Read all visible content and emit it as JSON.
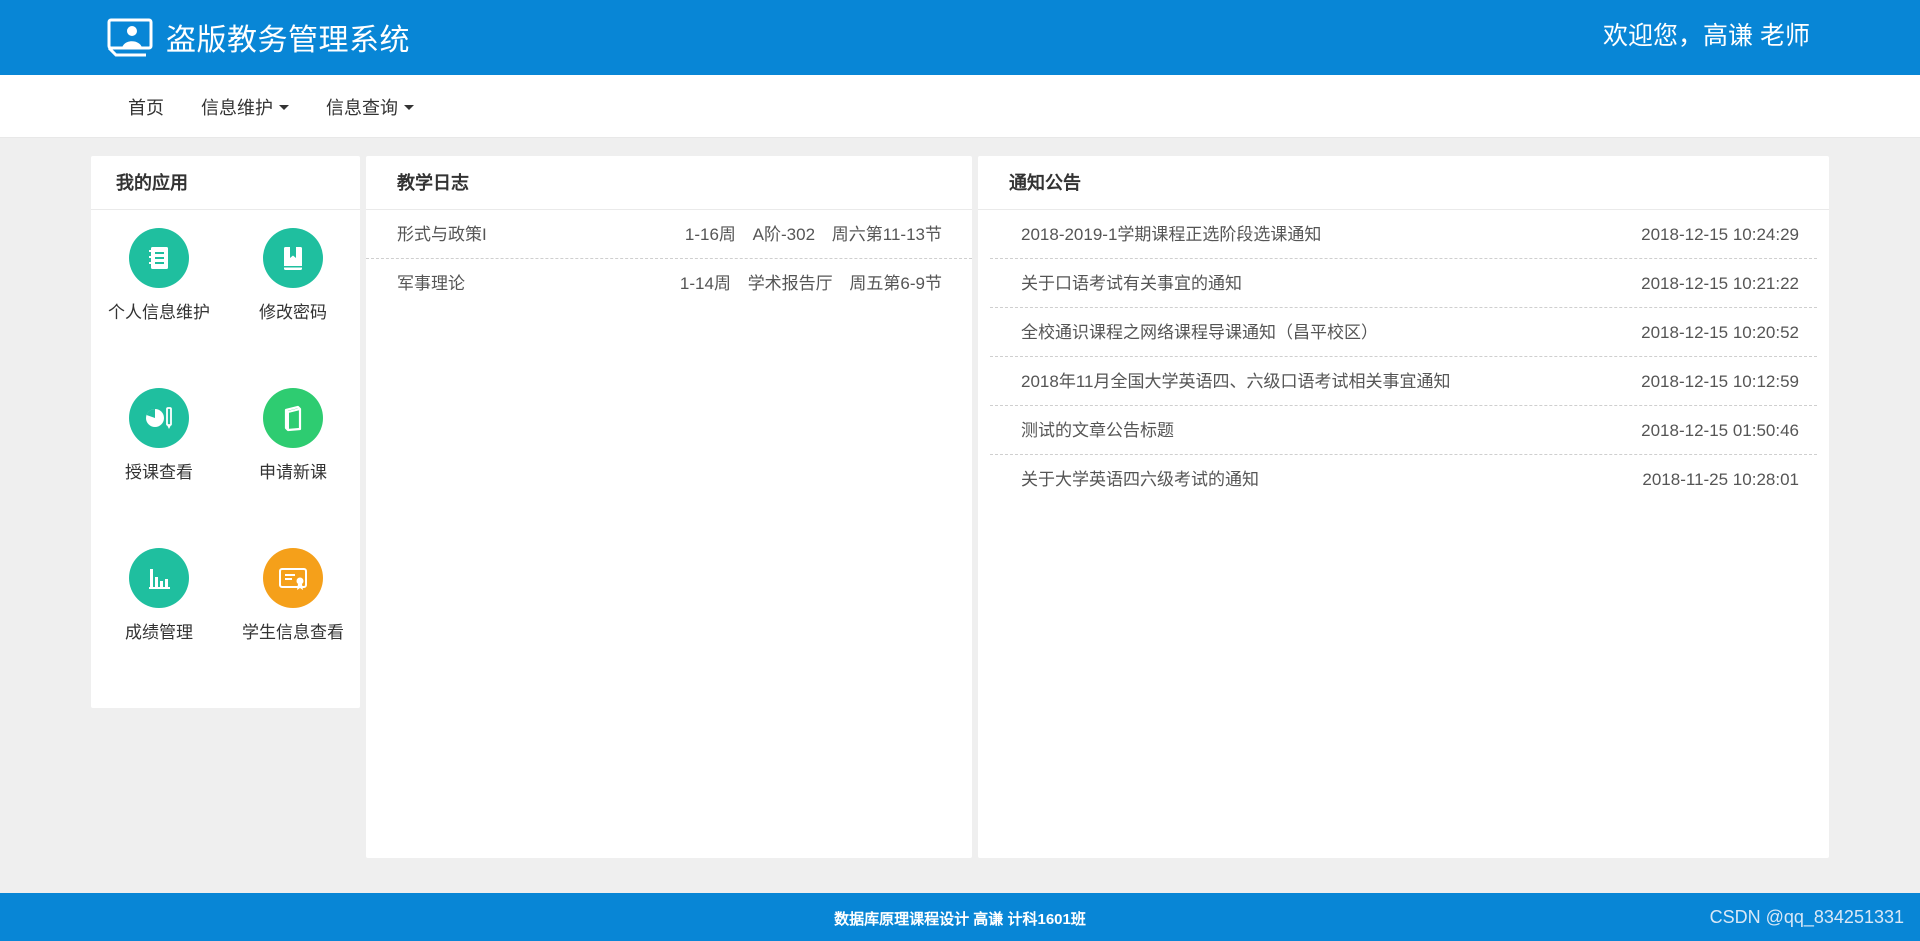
{
  "header": {
    "title": "盗版教务管理系统",
    "welcome": "欢迎您，高谦 老师",
    "icon": "monitor-user-icon"
  },
  "nav": {
    "items": [
      {
        "label": "首页",
        "dropdown": false
      },
      {
        "label": "信息维护",
        "dropdown": true
      },
      {
        "label": "信息查询",
        "dropdown": true
      }
    ]
  },
  "apps": {
    "title": "我的应用",
    "items": [
      {
        "label": "个人信息维护",
        "icon": "notebook-icon",
        "color": "#1fbf9f"
      },
      {
        "label": "修改密码",
        "icon": "bookmark-book-icon",
        "color": "#1fbf9f"
      },
      {
        "label": "授课查看",
        "icon": "pie-chart-pencil-icon",
        "color": "#1fbf9f"
      },
      {
        "label": "申请新课",
        "icon": "book-icon",
        "color": "#2ecc71"
      },
      {
        "label": "成绩管理",
        "icon": "bar-chart-icon",
        "color": "#1fbf9f"
      },
      {
        "label": "学生信息查看",
        "icon": "certificate-icon",
        "color": "#f5a01a"
      }
    ]
  },
  "journal": {
    "title": "教学日志",
    "rows": [
      {
        "course": "形式与政策I",
        "weeks": "1-16周",
        "room": "A阶-302",
        "time": "周六第11-13节"
      },
      {
        "course": "军事理论",
        "weeks": "1-14周",
        "room": "学术报告厅",
        "time": "周五第6-9节"
      }
    ]
  },
  "notice": {
    "title": "通知公告",
    "rows": [
      {
        "title": "2018-2019-1学期课程正选阶段选课通知",
        "time": "2018-12-15 10:24:29"
      },
      {
        "title": "关于口语考试有关事宜的通知",
        "time": "2018-12-15 10:21:22"
      },
      {
        "title": "全校通识课程之网络课程导课通知（昌平校区）",
        "time": "2018-12-15 10:20:52"
      },
      {
        "title": "2018年11月全国大学英语四、六级口语考试相关事宜通知",
        "time": "2018-12-15 10:12:59"
      },
      {
        "title": "测试的文章公告标题",
        "time": "2018-12-15 01:50:46"
      },
      {
        "title": "关于大学英语四六级考试的通知",
        "time": "2018-11-25 10:28:01"
      }
    ]
  },
  "footer": {
    "text": "数据库原理课程设计 高谦 计科1601班",
    "watermark": "CSDN @qq_834251331"
  },
  "colors": {
    "primary": "#0886d6",
    "background": "#efefef"
  }
}
